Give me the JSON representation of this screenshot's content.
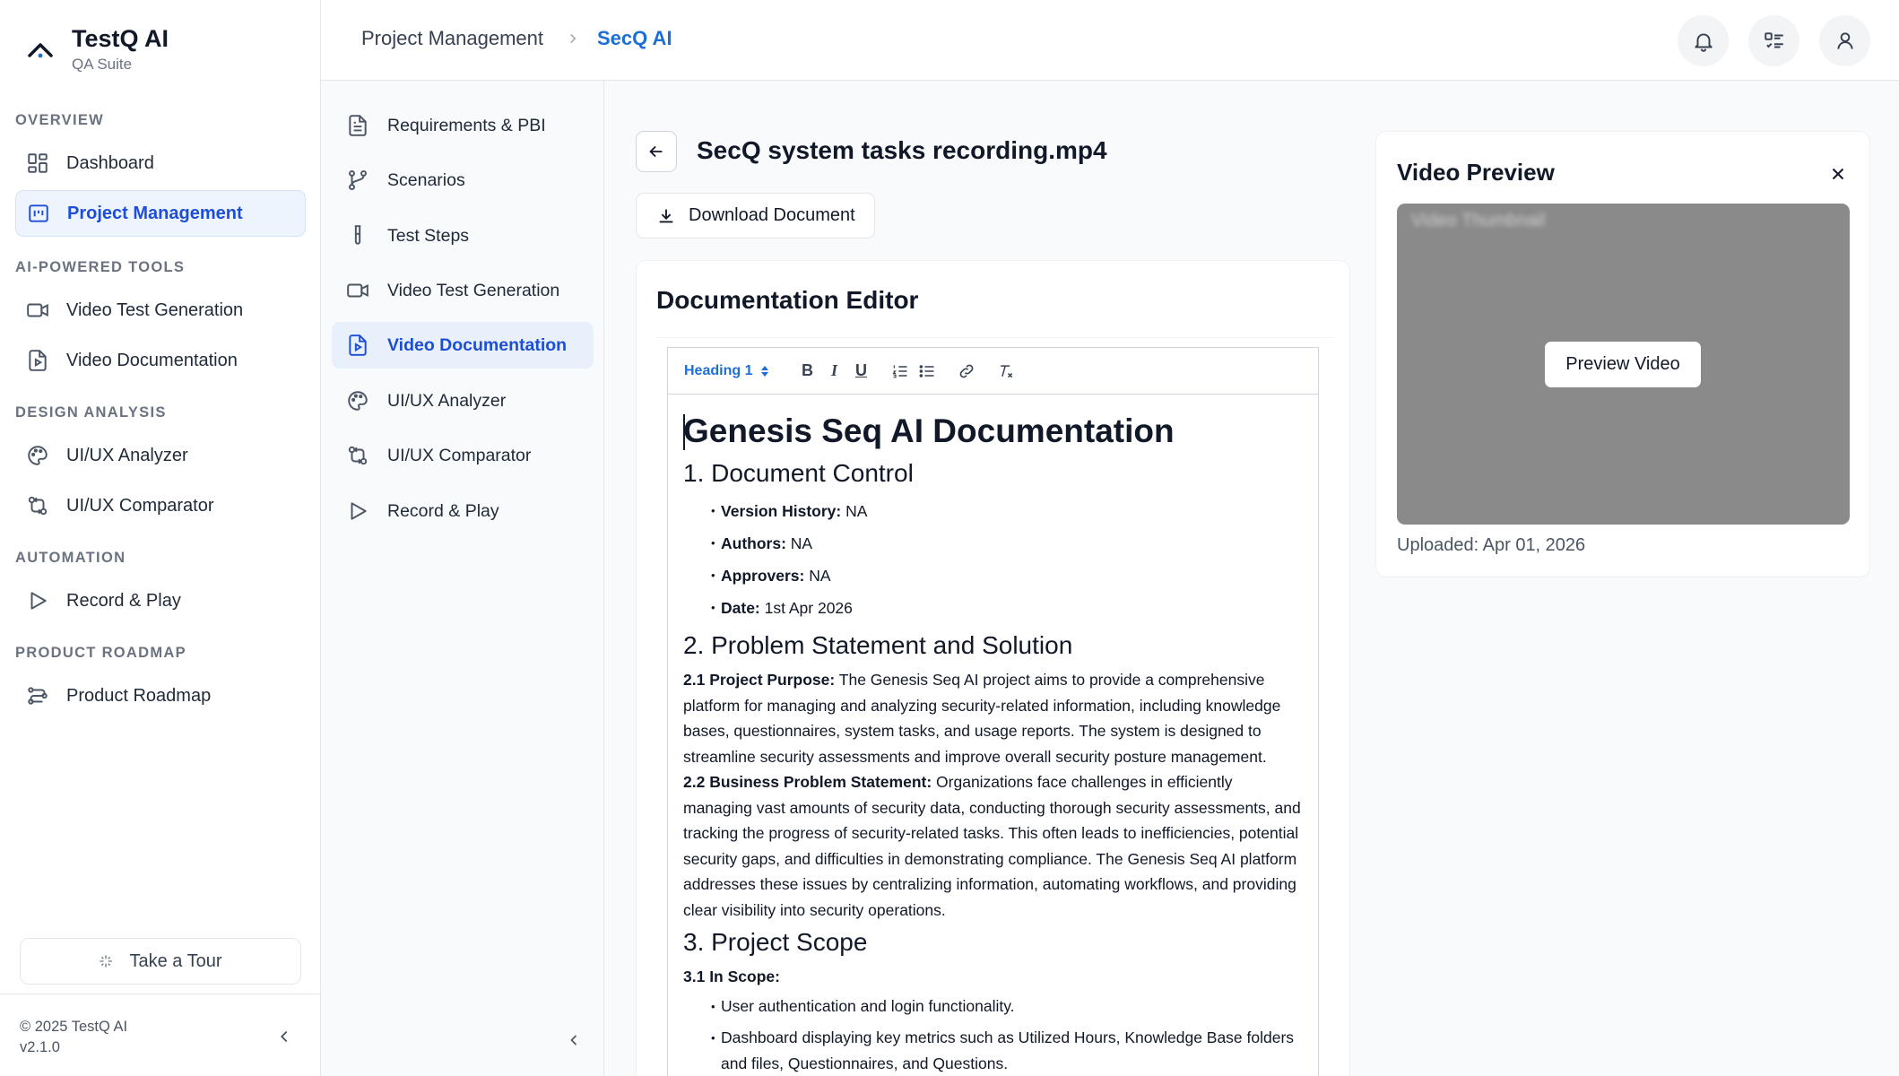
{
  "brand": {
    "name": "TestQ AI",
    "subtitle": "QA Suite"
  },
  "sidebar": {
    "sections": [
      {
        "title": "OVERVIEW"
      },
      {
        "title": "AI-POWERED TOOLS"
      },
      {
        "title": "DESIGN ANALYSIS"
      },
      {
        "title": "AUTOMATION"
      },
      {
        "title": "PRODUCT ROADMAP"
      }
    ],
    "items": [
      {
        "label": "Dashboard",
        "icon": "dashboard-icon"
      },
      {
        "label": "Project Management",
        "icon": "project-icon",
        "active": true
      },
      {
        "label": "Video Test Generation",
        "icon": "video-icon"
      },
      {
        "label": "Video Documentation",
        "icon": "video-doc-icon"
      },
      {
        "label": "UI/UX Analyzer",
        "icon": "palette-icon"
      },
      {
        "label": "UI/UX Comparator",
        "icon": "compare-icon"
      },
      {
        "label": "Record & Play",
        "icon": "play-icon"
      },
      {
        "label": "Product Roadmap",
        "icon": "roadmap-icon"
      }
    ],
    "tour_label": "Take a Tour",
    "copyright": "© 2025 TestQ AI",
    "version": "v2.1.0"
  },
  "header": {
    "breadcrumb": [
      "Project Management",
      "SecQ AI"
    ]
  },
  "subnav": {
    "items": [
      {
        "label": "Requirements & PBI",
        "icon": "document-icon"
      },
      {
        "label": "Scenarios",
        "icon": "branch-icon"
      },
      {
        "label": "Test Steps",
        "icon": "test-tube-icon"
      },
      {
        "label": "Video Test Generation",
        "icon": "video-icon"
      },
      {
        "label": "Video Documentation",
        "icon": "video-doc-icon",
        "active": true
      },
      {
        "label": "UI/UX Analyzer",
        "icon": "palette-icon"
      },
      {
        "label": "UI/UX Comparator",
        "icon": "compare-icon"
      },
      {
        "label": "Record & Play",
        "icon": "play-icon"
      }
    ]
  },
  "main": {
    "doc_title": "SecQ system tasks recording.mp4",
    "download_label": "Download Document",
    "editor": {
      "heading": "Documentation Editor",
      "toolbar": {
        "block_format": "Heading 1",
        "bold": "B",
        "italic": "I",
        "underline": "U"
      },
      "content": {
        "h1": "Genesis Seq AI Documentation",
        "s1_title": "1. Document Control",
        "s1_items": [
          {
            "label": "Version History:",
            "value": " NA"
          },
          {
            "label": "Authors:",
            "value": " NA"
          },
          {
            "label": "Approvers:",
            "value": " NA"
          },
          {
            "label": "Date:",
            "value": " 1st Apr 2026"
          }
        ],
        "s2_title": "2. Problem Statement and Solution",
        "s2_p1_label": "2.1 Project Purpose:",
        "s2_p1_text": " The Genesis Seq AI project aims to provide a comprehensive platform for managing and analyzing security-related information, including knowledge bases, questionnaires, system tasks, and usage reports. The system is designed to streamline security assessments and improve overall security posture management.",
        "s2_p2_label": "2.2 Business Problem Statement:",
        "s2_p2_text": " Organizations face challenges in efficiently managing vast amounts of security data, conducting thorough security assessments, and tracking the progress of security-related tasks. This often leads to inefficiencies, potential security gaps, and difficulties in demonstrating compliance. The Genesis Seq AI platform addresses these issues by centralizing information, automating workflows, and providing clear visibility into security operations.",
        "s3_title": "3. Project Scope",
        "s3_sub": "3.1 In Scope:",
        "s3_items": [
          "User authentication and login functionality.",
          "Dashboard displaying key metrics such as Utilized Hours, Knowledge Base folders and files, Questionnaires, and Questions."
        ]
      }
    }
  },
  "video_preview": {
    "title": "Video Preview",
    "thumbnail_alt": "Video Thumbnail",
    "button_label": "Preview Video",
    "uploaded": "Uploaded: Apr 01, 2026"
  }
}
